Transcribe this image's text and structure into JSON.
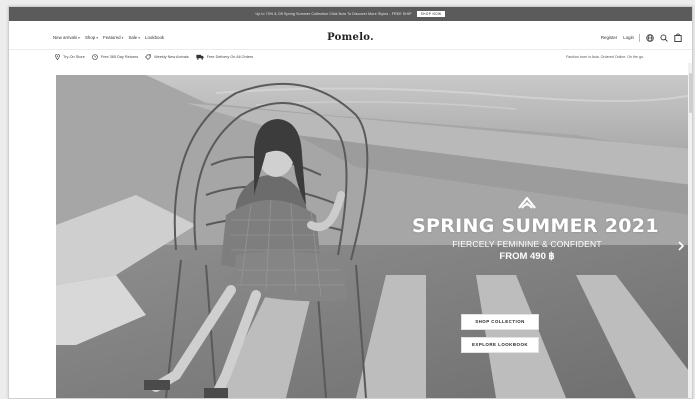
{
  "promo": {
    "text": "Up to 70% & Off Spring Summer Collection  Click Now To Discover More Styles - FREE SHIP",
    "button": "SHOP NOW"
  },
  "nav": {
    "items": [
      {
        "label": "New arrivals"
      },
      {
        "label": "Shop"
      },
      {
        "label": "Featured"
      },
      {
        "label": "Sale"
      },
      {
        "label": "Lookbook"
      }
    ],
    "logo": "Pomelo.",
    "register": "Register",
    "login": "Login"
  },
  "usp": {
    "items": [
      {
        "label": "Try-On Store",
        "icon": "location-pin-icon"
      },
      {
        "label": "Free 365 Day Returns",
        "icon": "clock-icon"
      },
      {
        "label": "Weekly New Arrivals",
        "icon": "tag-icon"
      },
      {
        "label": "Free Delivery On All Orders",
        "icon": "truck-icon"
      }
    ],
    "right_text": "Fashion born in Asia. Ordered Online. On the go."
  },
  "hero": {
    "title": "SPRING SUMMER 2021",
    "subtitle": "FIERCELY FEMININE & CONFIDENT",
    "price": "FROM 490 ฿",
    "shop_button": "SHOP COLLECTION",
    "lookbook_button": "EXPLORE LOOKBOOK"
  },
  "colors": {
    "promo_bg": "#5b5b5b",
    "page_bg": "#ededed",
    "hero_text": "#ffffff"
  }
}
